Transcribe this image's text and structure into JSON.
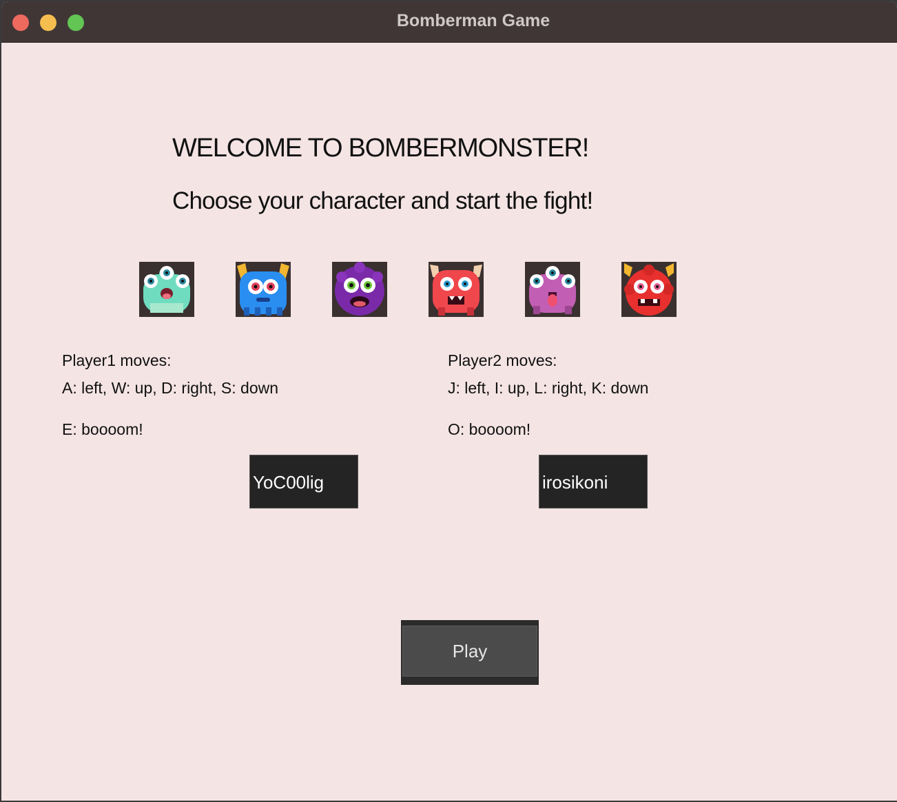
{
  "window": {
    "title": "Bomberman Game"
  },
  "welcome": {
    "heading": "WELCOME TO BOMBERMONSTER!",
    "subheading": "Choose your character and start the fight!"
  },
  "characters": [
    {
      "name": "teal-three-eyed-monster",
      "color": "#6fdcbf"
    },
    {
      "name": "blue-horned-monster",
      "color": "#2a8ef0"
    },
    {
      "name": "purple-fuzzy-monster",
      "color": "#7a2aa8"
    },
    {
      "name": "red-horned-monster",
      "color": "#f0474c"
    },
    {
      "name": "pink-three-eyed-monster",
      "color": "#c25fb4"
    },
    {
      "name": "red-fuzzy-monster",
      "color": "#e8302e"
    }
  ],
  "player1": {
    "title": "Player1 moves:",
    "moves": "A: left, W: up, D: right, S: down",
    "bomb": "E: boooom!",
    "name_value": "YoC00lig"
  },
  "player2": {
    "title": "Player2 moves:",
    "moves": "J: left, I: up, L: right, K: down",
    "bomb": "O: boooom!",
    "name_value": "irosikoni"
  },
  "play_button": {
    "label": "Play"
  },
  "colors": {
    "background": "#f4e4e4",
    "titlebar": "#413636",
    "namebox": "#242424",
    "play_button": "#4b4b4b"
  }
}
